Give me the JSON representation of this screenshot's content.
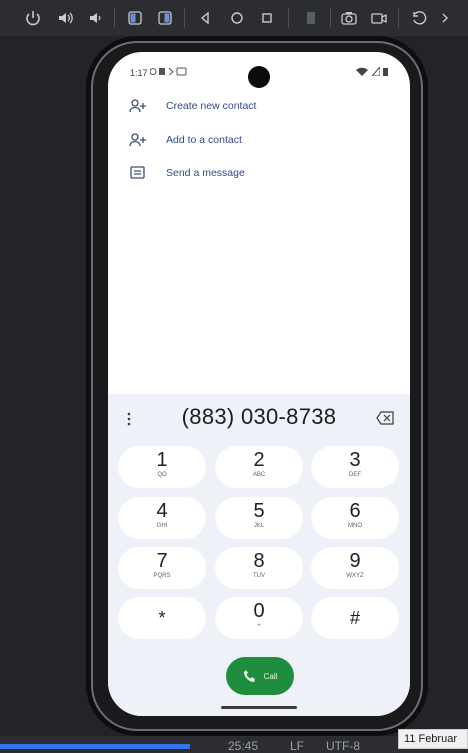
{
  "status_bar": {
    "time": "1:17"
  },
  "menu": [
    {
      "label": "Create new contact",
      "icon": "add-person-icon"
    },
    {
      "label": "Add to a contact",
      "icon": "add-person-icon"
    },
    {
      "label": "Send a message",
      "icon": "message-icon"
    }
  ],
  "dialer": {
    "number": "(883) 030-8738",
    "keys": [
      {
        "digit": "1",
        "letters": "QO"
      },
      {
        "digit": "2",
        "letters": "ABC"
      },
      {
        "digit": "3",
        "letters": "DEF"
      },
      {
        "digit": "4",
        "letters": "GHI"
      },
      {
        "digit": "5",
        "letters": "JKL"
      },
      {
        "digit": "6",
        "letters": "MNO"
      },
      {
        "digit": "7",
        "letters": "PQRS"
      },
      {
        "digit": "8",
        "letters": "TUV"
      },
      {
        "digit": "9",
        "letters": "WXYZ"
      },
      {
        "digit": "*",
        "letters": ""
      },
      {
        "digit": "0",
        "letters": "+"
      },
      {
        "digit": "#",
        "letters": ""
      }
    ],
    "call_label": "Call"
  },
  "host": {
    "clock_fragment": "25:45",
    "line_ending": "LF",
    "encoding": "UTF-8",
    "date_tooltip": "11 Februar"
  },
  "colors": {
    "accent": "#1e8e3e",
    "link": "#2f4b85",
    "pad_bg": "#eef1f8"
  }
}
